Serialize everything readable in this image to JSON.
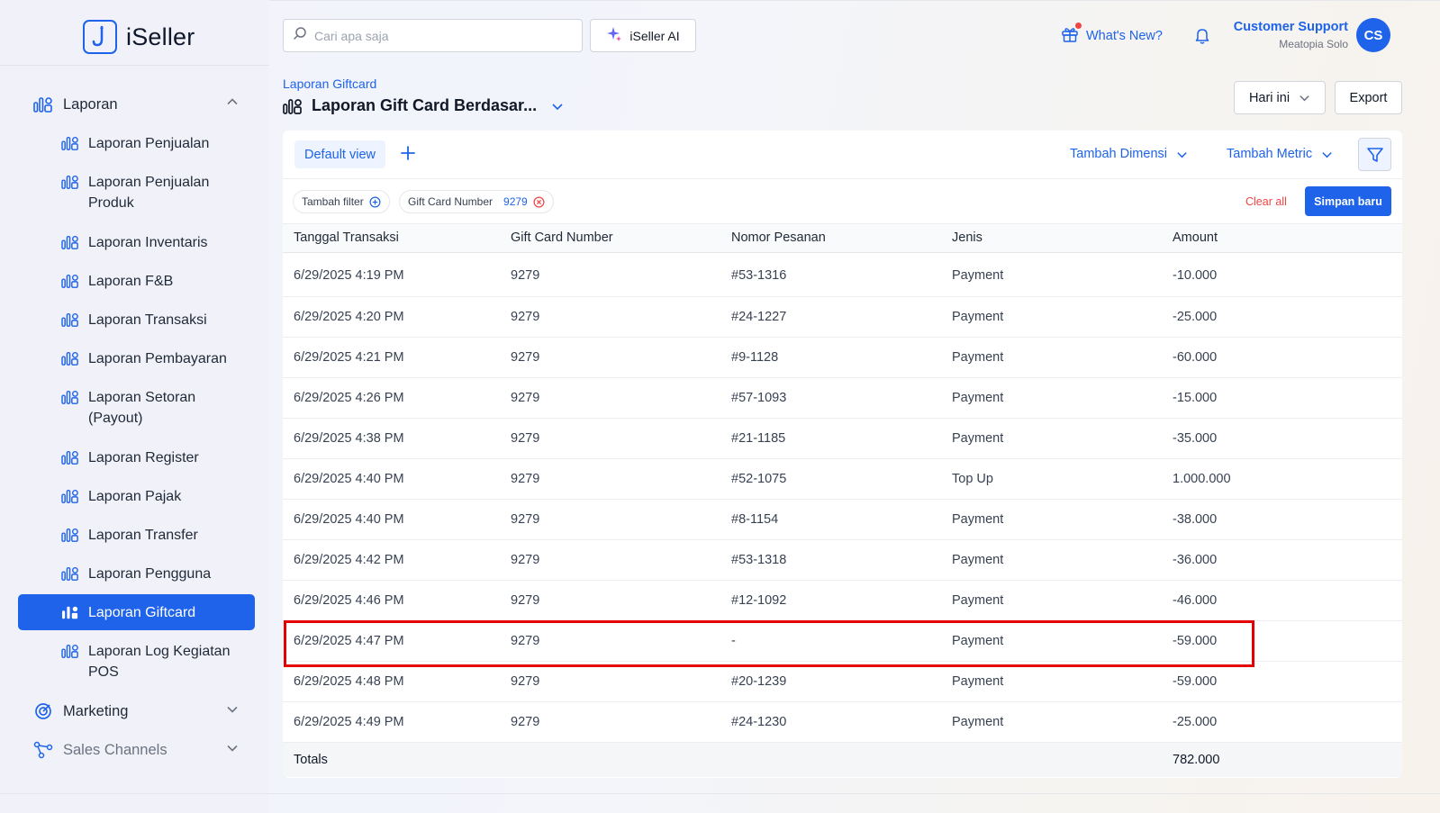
{
  "app": {
    "name": "iSeller"
  },
  "search": {
    "placeholder": "Cari apa saja"
  },
  "header": {
    "ai_label": "iSeller AI",
    "whats_new": "What's New?",
    "user_name": "Customer Support",
    "user_store": "Meatopia Solo",
    "avatar_initials": "CS"
  },
  "sidebar": {
    "group_laporan": "Laporan",
    "items": [
      {
        "label": "Laporan Penjualan"
      },
      {
        "label": "Laporan Penjualan Produk"
      },
      {
        "label": "Laporan Inventaris"
      },
      {
        "label": "Laporan F&B"
      },
      {
        "label": "Laporan Transaksi"
      },
      {
        "label": "Laporan Pembayaran"
      },
      {
        "label": "Laporan Setoran (Payout)"
      },
      {
        "label": "Laporan Register"
      },
      {
        "label": "Laporan Pajak"
      },
      {
        "label": "Laporan Transfer"
      },
      {
        "label": "Laporan Pengguna"
      },
      {
        "label": "Laporan Giftcard",
        "active": true
      },
      {
        "label": "Laporan Log Kegiatan POS"
      }
    ],
    "group_marketing": "Marketing",
    "group_sales_channels": "Sales Channels"
  },
  "page": {
    "breadcrumb": "Laporan Giftcard",
    "title": "Laporan Gift Card Berdasar...",
    "date_range": "Hari ini",
    "export": "Export"
  },
  "toolbar": {
    "default_view": "Default view",
    "add_dimension": "Tambah Dimensi",
    "add_metric": "Tambah Metric"
  },
  "filters": {
    "add_filter": "Tambah filter",
    "chip_label": "Gift Card Number",
    "chip_value": "9279",
    "clear_all": "Clear all",
    "save_new": "Simpan baru"
  },
  "table": {
    "columns": [
      "Tanggal Transaksi",
      "Gift Card Number",
      "Nomor Pesanan",
      "Jenis",
      "Amount"
    ],
    "rows": [
      [
        "6/29/2025 4:19 PM",
        "9279",
        "#53-1316",
        "Payment",
        "-10.000"
      ],
      [
        "6/29/2025 4:20 PM",
        "9279",
        "#24-1227",
        "Payment",
        "-25.000"
      ],
      [
        "6/29/2025 4:21 PM",
        "9279",
        "#9-1128",
        "Payment",
        "-60.000"
      ],
      [
        "6/29/2025 4:26 PM",
        "9279",
        "#57-1093",
        "Payment",
        "-15.000"
      ],
      [
        "6/29/2025 4:38 PM",
        "9279",
        "#21-1185",
        "Payment",
        "-35.000"
      ],
      [
        "6/29/2025 4:40 PM",
        "9279",
        "#52-1075",
        "Top Up",
        "1.000.000"
      ],
      [
        "6/29/2025 4:40 PM",
        "9279",
        "#8-1154",
        "Payment",
        "-38.000"
      ],
      [
        "6/29/2025 4:42 PM",
        "9279",
        "#53-1318",
        "Payment",
        "-36.000"
      ],
      [
        "6/29/2025 4:46 PM",
        "9279",
        "#12-1092",
        "Payment",
        "-46.000"
      ],
      [
        "6/29/2025 4:47 PM",
        "9279",
        "-",
        "Payment",
        "-59.000"
      ],
      [
        "6/29/2025 4:48 PM",
        "9279",
        "#20-1239",
        "Payment",
        "-59.000"
      ],
      [
        "6/29/2025 4:49 PM",
        "9279",
        "#24-1230",
        "Payment",
        "-25.000"
      ]
    ],
    "totals_label": "Totals",
    "totals_amount": "782.000"
  },
  "colors": {
    "accent": "#1e63e9",
    "highlight": "#e40000",
    "danger": "#ef4444"
  }
}
